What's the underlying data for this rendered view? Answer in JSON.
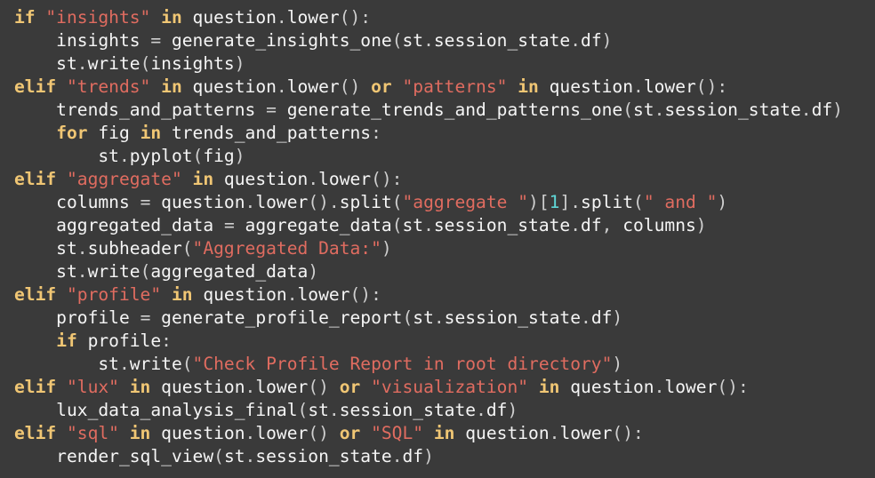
{
  "editor": {
    "lines": [
      [
        [
          "kw",
          "if"
        ],
        [
          "tx",
          " "
        ],
        [
          "st",
          "\"insights\""
        ],
        [
          "tx",
          " "
        ],
        [
          "kw",
          "in"
        ],
        [
          "tx",
          " question"
        ],
        [
          "pn",
          "."
        ],
        [
          "tx",
          "lower"
        ],
        [
          "pn",
          "():"
        ]
      ],
      [
        [
          "tx",
          "    insights "
        ],
        [
          "pn",
          "="
        ],
        [
          "tx",
          " generate_insights_one"
        ],
        [
          "pn",
          "("
        ],
        [
          "tx",
          "st"
        ],
        [
          "pn",
          "."
        ],
        [
          "tx",
          "session_state"
        ],
        [
          "pn",
          "."
        ],
        [
          "tx",
          "df"
        ],
        [
          "pn",
          ")"
        ]
      ],
      [
        [
          "tx",
          "    st"
        ],
        [
          "pn",
          "."
        ],
        [
          "tx",
          "write"
        ],
        [
          "pn",
          "("
        ],
        [
          "tx",
          "insights"
        ],
        [
          "pn",
          ")"
        ]
      ],
      [
        [
          "kw",
          "elif"
        ],
        [
          "tx",
          " "
        ],
        [
          "st",
          "\"trends\""
        ],
        [
          "tx",
          " "
        ],
        [
          "kw",
          "in"
        ],
        [
          "tx",
          " question"
        ],
        [
          "pn",
          "."
        ],
        [
          "tx",
          "lower"
        ],
        [
          "pn",
          "()"
        ],
        [
          "tx",
          " "
        ],
        [
          "kw",
          "or"
        ],
        [
          "tx",
          " "
        ],
        [
          "st",
          "\"patterns\""
        ],
        [
          "tx",
          " "
        ],
        [
          "kw",
          "in"
        ],
        [
          "tx",
          " question"
        ],
        [
          "pn",
          "."
        ],
        [
          "tx",
          "lower"
        ],
        [
          "pn",
          "():"
        ]
      ],
      [
        [
          "tx",
          "    trends_and_patterns "
        ],
        [
          "pn",
          "="
        ],
        [
          "tx",
          " generate_trends_and_patterns_one"
        ],
        [
          "pn",
          "("
        ],
        [
          "tx",
          "st"
        ],
        [
          "pn",
          "."
        ],
        [
          "tx",
          "session_state"
        ],
        [
          "pn",
          "."
        ],
        [
          "tx",
          "df"
        ],
        [
          "pn",
          ")"
        ]
      ],
      [
        [
          "tx",
          "    "
        ],
        [
          "kw",
          "for"
        ],
        [
          "tx",
          " fig "
        ],
        [
          "kw",
          "in"
        ],
        [
          "tx",
          " trends_and_patterns"
        ],
        [
          "pn",
          ":"
        ]
      ],
      [
        [
          "tx",
          "        st"
        ],
        [
          "pn",
          "."
        ],
        [
          "tx",
          "pyplot"
        ],
        [
          "pn",
          "("
        ],
        [
          "tx",
          "fig"
        ],
        [
          "pn",
          ")"
        ]
      ],
      [
        [
          "kw",
          "elif"
        ],
        [
          "tx",
          " "
        ],
        [
          "st",
          "\"aggregate\""
        ],
        [
          "tx",
          " "
        ],
        [
          "kw",
          "in"
        ],
        [
          "tx",
          " question"
        ],
        [
          "pn",
          "."
        ],
        [
          "tx",
          "lower"
        ],
        [
          "pn",
          "():"
        ]
      ],
      [
        [
          "tx",
          "    columns "
        ],
        [
          "pn",
          "="
        ],
        [
          "tx",
          " question"
        ],
        [
          "pn",
          "."
        ],
        [
          "tx",
          "lower"
        ],
        [
          "pn",
          "()."
        ],
        [
          "tx",
          "split"
        ],
        [
          "pn",
          "("
        ],
        [
          "st",
          "\"aggregate \""
        ],
        [
          "pn",
          ")["
        ],
        [
          "nm",
          "1"
        ],
        [
          "pn",
          "]."
        ],
        [
          "tx",
          "split"
        ],
        [
          "pn",
          "("
        ],
        [
          "st",
          "\" and \""
        ],
        [
          "pn",
          ")"
        ]
      ],
      [
        [
          "tx",
          "    aggregated_data "
        ],
        [
          "pn",
          "="
        ],
        [
          "tx",
          " aggregate_data"
        ],
        [
          "pn",
          "("
        ],
        [
          "tx",
          "st"
        ],
        [
          "pn",
          "."
        ],
        [
          "tx",
          "session_state"
        ],
        [
          "pn",
          "."
        ],
        [
          "tx",
          "df"
        ],
        [
          "pn",
          ","
        ],
        [
          "tx",
          " columns"
        ],
        [
          "pn",
          ")"
        ]
      ],
      [
        [
          "tx",
          "    st"
        ],
        [
          "pn",
          "."
        ],
        [
          "tx",
          "subheader"
        ],
        [
          "pn",
          "("
        ],
        [
          "st",
          "\"Aggregated Data:\""
        ],
        [
          "pn",
          ")"
        ]
      ],
      [
        [
          "tx",
          "    st"
        ],
        [
          "pn",
          "."
        ],
        [
          "tx",
          "write"
        ],
        [
          "pn",
          "("
        ],
        [
          "tx",
          "aggregated_data"
        ],
        [
          "pn",
          ")"
        ]
      ],
      [
        [
          "kw",
          "elif"
        ],
        [
          "tx",
          " "
        ],
        [
          "st",
          "\"profile\""
        ],
        [
          "tx",
          " "
        ],
        [
          "kw",
          "in"
        ],
        [
          "tx",
          " question"
        ],
        [
          "pn",
          "."
        ],
        [
          "tx",
          "lower"
        ],
        [
          "pn",
          "():"
        ]
      ],
      [
        [
          "tx",
          "    profile "
        ],
        [
          "pn",
          "="
        ],
        [
          "tx",
          " generate_profile_report"
        ],
        [
          "pn",
          "("
        ],
        [
          "tx",
          "st"
        ],
        [
          "pn",
          "."
        ],
        [
          "tx",
          "session_state"
        ],
        [
          "pn",
          "."
        ],
        [
          "tx",
          "df"
        ],
        [
          "pn",
          ")"
        ]
      ],
      [
        [
          "tx",
          "    "
        ],
        [
          "kw",
          "if"
        ],
        [
          "tx",
          " profile"
        ],
        [
          "pn",
          ":"
        ]
      ],
      [
        [
          "tx",
          "        st"
        ],
        [
          "pn",
          "."
        ],
        [
          "tx",
          "write"
        ],
        [
          "pn",
          "("
        ],
        [
          "st",
          "\"Check Profile Report in root directory\""
        ],
        [
          "pn",
          ")"
        ]
      ],
      [
        [
          "kw",
          "elif"
        ],
        [
          "tx",
          " "
        ],
        [
          "st",
          "\"lux\""
        ],
        [
          "tx",
          " "
        ],
        [
          "kw",
          "in"
        ],
        [
          "tx",
          " question"
        ],
        [
          "pn",
          "."
        ],
        [
          "tx",
          "lower"
        ],
        [
          "pn",
          "()"
        ],
        [
          "tx",
          " "
        ],
        [
          "kw",
          "or"
        ],
        [
          "tx",
          " "
        ],
        [
          "st",
          "\"visualization\""
        ],
        [
          "tx",
          " "
        ],
        [
          "kw",
          "in"
        ],
        [
          "tx",
          " question"
        ],
        [
          "pn",
          "."
        ],
        [
          "tx",
          "lower"
        ],
        [
          "pn",
          "():"
        ]
      ],
      [
        [
          "tx",
          "    lux_data_analysis_final"
        ],
        [
          "pn",
          "("
        ],
        [
          "tx",
          "st"
        ],
        [
          "pn",
          "."
        ],
        [
          "tx",
          "session_state"
        ],
        [
          "pn",
          "."
        ],
        [
          "tx",
          "df"
        ],
        [
          "pn",
          ")"
        ]
      ],
      [
        [
          "kw",
          "elif"
        ],
        [
          "tx",
          " "
        ],
        [
          "st",
          "\"sql\""
        ],
        [
          "tx",
          " "
        ],
        [
          "kw",
          "in"
        ],
        [
          "tx",
          " question"
        ],
        [
          "pn",
          "."
        ],
        [
          "tx",
          "lower"
        ],
        [
          "pn",
          "()"
        ],
        [
          "tx",
          " "
        ],
        [
          "kw",
          "or"
        ],
        [
          "tx",
          " "
        ],
        [
          "st",
          "\"SQL\""
        ],
        [
          "tx",
          " "
        ],
        [
          "kw",
          "in"
        ],
        [
          "tx",
          " question"
        ],
        [
          "pn",
          "."
        ],
        [
          "tx",
          "lower"
        ],
        [
          "pn",
          "():"
        ]
      ],
      [
        [
          "tx",
          "    render_sql_view"
        ],
        [
          "pn",
          "("
        ],
        [
          "tx",
          "st"
        ],
        [
          "pn",
          "."
        ],
        [
          "tx",
          "session_state"
        ],
        [
          "pn",
          "."
        ],
        [
          "tx",
          "df"
        ],
        [
          "pn",
          ")"
        ]
      ]
    ]
  }
}
